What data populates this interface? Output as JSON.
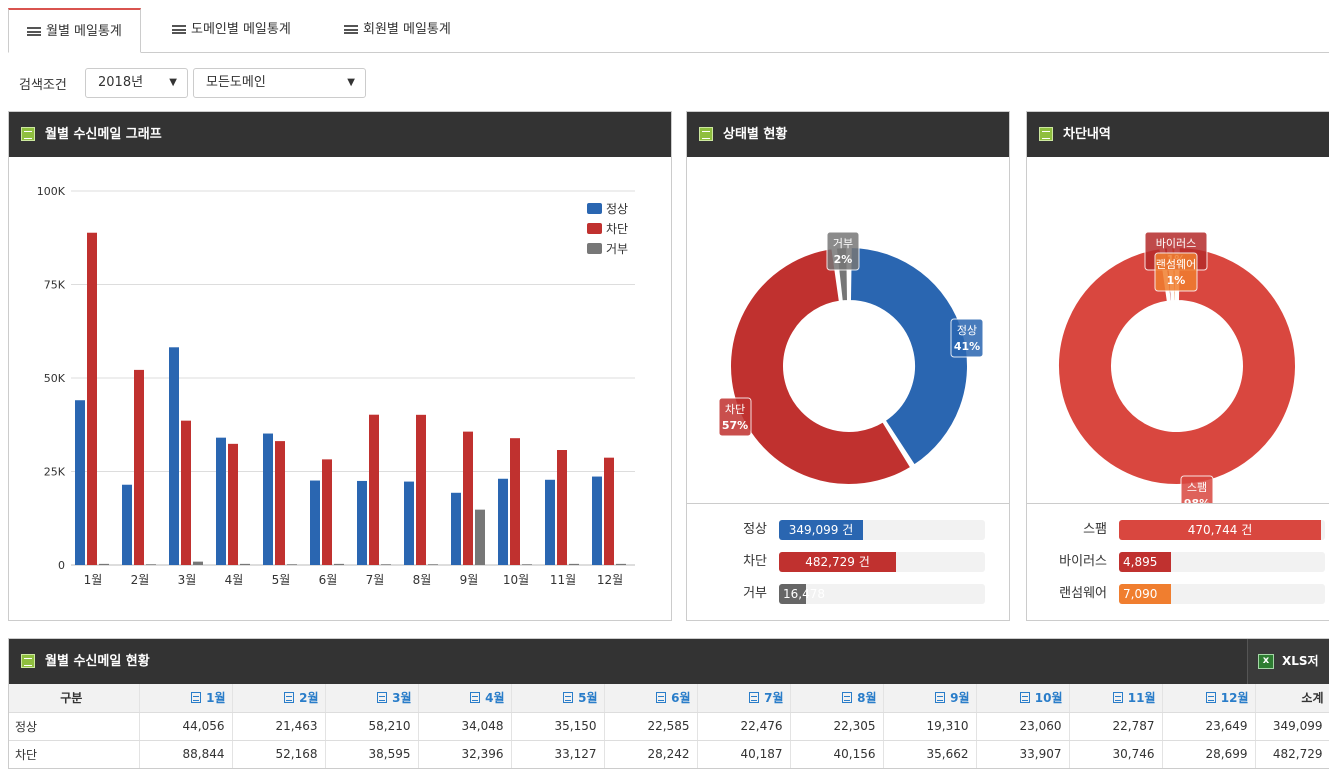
{
  "tabs": [
    {
      "label": "월별 메일통계",
      "active": true
    },
    {
      "label": "도메인별 메일통계",
      "active": false
    },
    {
      "label": "회원별 메일통계",
      "active": false
    }
  ],
  "filter": {
    "label": "검색조건",
    "year": "2018년",
    "domain": "모든도메인"
  },
  "monthly_chart": {
    "title": "월별 수신메일 그래프",
    "chart_data": {
      "type": "bar",
      "categories": [
        "1월",
        "2월",
        "3월",
        "4월",
        "5월",
        "6월",
        "7월",
        "8월",
        "9월",
        "10월",
        "11월",
        "12월"
      ],
      "series": [
        {
          "name": "정상",
          "color": "#2a66b1",
          "values": [
            44056,
            21463,
            58210,
            34048,
            35150,
            22585,
            22476,
            22305,
            19310,
            23060,
            22787,
            23649
          ]
        },
        {
          "name": "차단",
          "color": "#c0312f",
          "values": [
            88844,
            52168,
            38595,
            32396,
            33127,
            28242,
            40187,
            40156,
            35662,
            33907,
            30746,
            28699
          ]
        },
        {
          "name": "거부",
          "color": "#777777",
          "values": [
            300,
            200,
            900,
            300,
            200,
            300,
            200,
            200,
            14800,
            200,
            300,
            300
          ]
        }
      ],
      "yticks": [
        "0",
        "25K",
        "50K",
        "75K",
        "100K"
      ],
      "ylim": [
        0,
        100000
      ],
      "legend": "top-right",
      "grid": true
    }
  },
  "status_chart": {
    "title": "상태별 현황",
    "chart_data": {
      "type": "pie",
      "slices": [
        {
          "name": "정상",
          "percent": 41,
          "color": "#2a66b1",
          "label": "정상",
          "pct_label": "41%"
        },
        {
          "name": "차단",
          "percent": 57,
          "color": "#c0312f",
          "label": "차단",
          "pct_label": "57%"
        },
        {
          "name": "거부",
          "percent": 2,
          "color": "#777777",
          "label": "거부",
          "pct_label": "2%"
        }
      ]
    },
    "bars": [
      {
        "label": "정상",
        "value": "349,099 건",
        "fraction": 0.41,
        "color": "#2a66b1"
      },
      {
        "label": "차단",
        "value": "482,729 건",
        "fraction": 0.57,
        "color": "#c0312f"
      },
      {
        "label": "거부",
        "value": "16,478",
        "fraction": 0.13,
        "color": "#666666"
      }
    ]
  },
  "block_chart": {
    "title": "차단내역",
    "chart_data": {
      "type": "pie",
      "slices": [
        {
          "name": "스팸",
          "percent": 98,
          "color": "#d9473f",
          "label": "스팸",
          "pct_label": "98%"
        },
        {
          "name": "바이러스",
          "percent": 1,
          "color": "#b52b2b",
          "label": "바이러스",
          "pct_label": "1%"
        },
        {
          "name": "랜섬웨어",
          "percent": 1,
          "color": "#f07e2f",
          "label": "랜섬웨어",
          "pct_label": "1%"
        }
      ]
    },
    "bars": [
      {
        "label": "스팸",
        "value": "470,744 건",
        "fraction": 0.98,
        "color": "#d9473f"
      },
      {
        "label": "바이러스",
        "value": "4,895",
        "fraction": 0.25,
        "color": "#c0312f"
      },
      {
        "label": "랜섬웨어",
        "value": "7,090",
        "fraction": 0.25,
        "color": "#f07e2f"
      }
    ]
  },
  "table": {
    "title": "월별 수신메일 현황",
    "export_label": "XLS저장",
    "headers": [
      "구분",
      "1월",
      "2월",
      "3월",
      "4월",
      "5월",
      "6월",
      "7월",
      "8월",
      "9월",
      "10월",
      "11월",
      "12월",
      "소계"
    ],
    "rows": [
      [
        "정상",
        "44,056",
        "21,463",
        "58,210",
        "34,048",
        "35,150",
        "22,585",
        "22,476",
        "22,305",
        "19,310",
        "23,060",
        "22,787",
        "23,649",
        "349,099"
      ],
      [
        "차단",
        "88,844",
        "52,168",
        "38,595",
        "32,396",
        "33,127",
        "28,242",
        "40,187",
        "40,156",
        "35,662",
        "33,907",
        "30,746",
        "28,699",
        "482,729"
      ]
    ]
  }
}
